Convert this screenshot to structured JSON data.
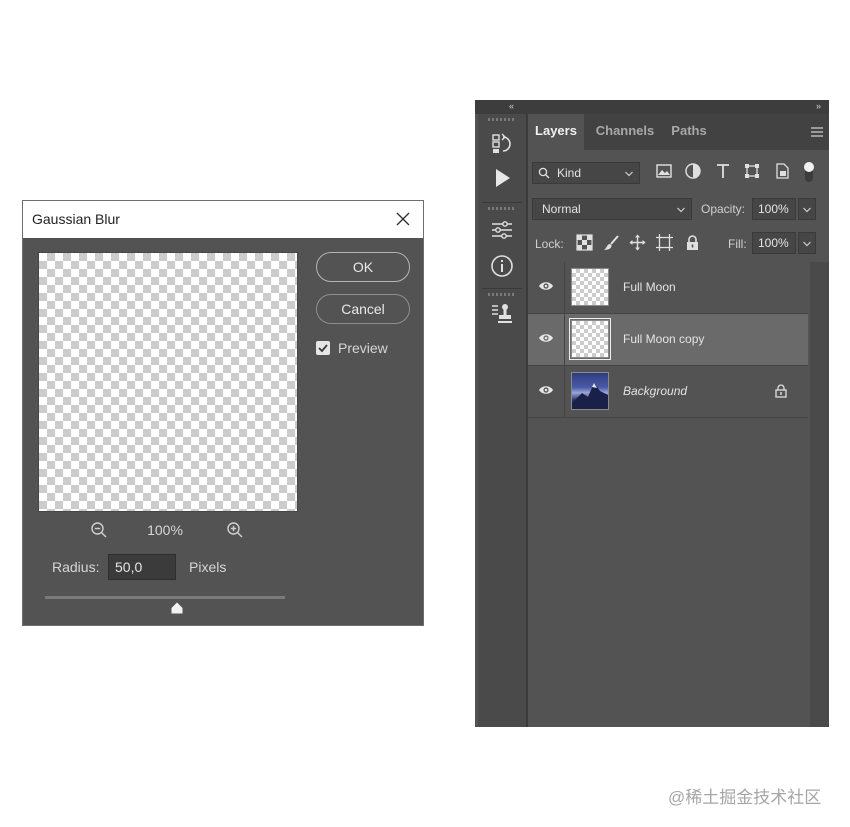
{
  "dialog": {
    "title": "Gaussian Blur",
    "zoom": "100%",
    "radius_label": "Radius:",
    "radius_value": "50,0",
    "radius_unit": "Pixels",
    "ok_label": "OK",
    "cancel_label": "Cancel",
    "preview_label": "Preview",
    "preview_checked": true
  },
  "panel": {
    "tabs": [
      {
        "label": "Layers",
        "active": true
      },
      {
        "label": "Channels",
        "active": false
      },
      {
        "label": "Paths",
        "active": false
      }
    ],
    "filter_label": "Kind",
    "blend_mode": "Normal",
    "opacity_label": "Opacity:",
    "opacity_value": "100%",
    "lock_label": "Lock:",
    "fill_label": "Fill:",
    "fill_value": "100%",
    "layers": [
      {
        "name": "Full Moon",
        "visible": true,
        "selected": false,
        "italic": false,
        "locked": false
      },
      {
        "name": "Full Moon copy",
        "visible": true,
        "selected": true,
        "italic": false,
        "locked": false
      },
      {
        "name": "Background",
        "visible": true,
        "selected": false,
        "italic": true,
        "locked": true
      }
    ]
  },
  "watermark": "@稀土掘金技术社区"
}
